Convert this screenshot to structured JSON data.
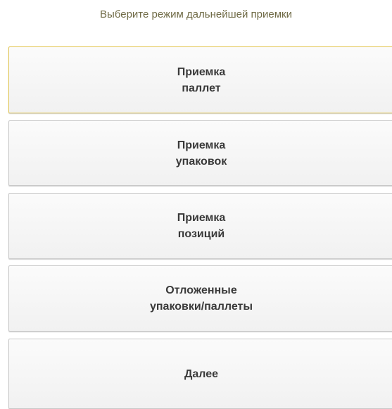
{
  "prompt": "Выберите режим дальнейшей приемки",
  "buttons": [
    {
      "label": "Приемка\nпаллет"
    },
    {
      "label": "Приемка\nупаковок"
    },
    {
      "label": "Приемка\nпозиций"
    },
    {
      "label": "Отложенные\nупаковки/паллеты"
    },
    {
      "label": "Далее"
    }
  ],
  "colors": {
    "prompt_text": "#6f6a45",
    "focus_border": "#e2c54e",
    "button_text": "#3a3a3a"
  }
}
